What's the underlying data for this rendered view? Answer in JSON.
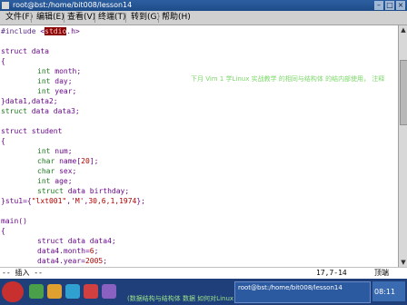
{
  "window": {
    "title": "root@bst:/home/bit008/lesson14",
    "minimize": "–",
    "maximize": "□",
    "close": "×"
  },
  "menu": [
    "文件(F)",
    "编辑(E)",
    "查看(V)",
    "终端(T)",
    "转到(G)",
    "帮助(H)"
  ],
  "code": {
    "include_kw": "#include",
    "include_open": " <",
    "include_name": "stdio",
    "include_close": ".h>",
    "l_struct_data": "struct data",
    "brace_open": "{",
    "l_int": "int",
    "l_month": " month;",
    "l_day": " day;",
    "l_year": " year;",
    "l_data_close": "}data1,data2;",
    "l_struct_kw": "struct",
    "l_data3": " data data3;",
    "l_struct_student": "struct student",
    "l_num": " num;",
    "l_char": "char",
    "l_name": " name[",
    "l_name_n": "20",
    "l_name_end": "];",
    "l_sex": " sex;",
    "l_age": " age;",
    "l_struct_kw2": "struct",
    "l_birthday": " data birthday;",
    "l_stu1_a": "}stu1={",
    "l_stu1_str1": "\"lxt001\"",
    "l_stu1_b": ",",
    "l_stu1_str2": "'M'",
    "l_stu1_c": ",",
    "l_stu1_nums": "30,6,1,1974",
    "l_stu1_end": "};",
    "l_main": "main()",
    "l_struct_data4": "struct data data4;",
    "l_month6_a": "data4.month=",
    "l_month6_b": "6",
    "l_month6_c": ";",
    "l_year_a": "data4.year=",
    "l_year_b": "2005",
    "l_year_c": ";"
  },
  "status": {
    "mode": "-- 插入 --",
    "position": "17,7-14",
    "scroll": "顶端"
  },
  "overlay": {
    "top": "下月 Vim 1 学Linux 实战教学 的相同与结构体 的结内部使用，  注释",
    "bottom": "(数据结构与结构体 数据 如何对Linux 如何 对数据 结构 加以注解)"
  },
  "taskbar": {
    "task": "root@bst:/home/bit008/lesson14",
    "clock": "08:11"
  }
}
